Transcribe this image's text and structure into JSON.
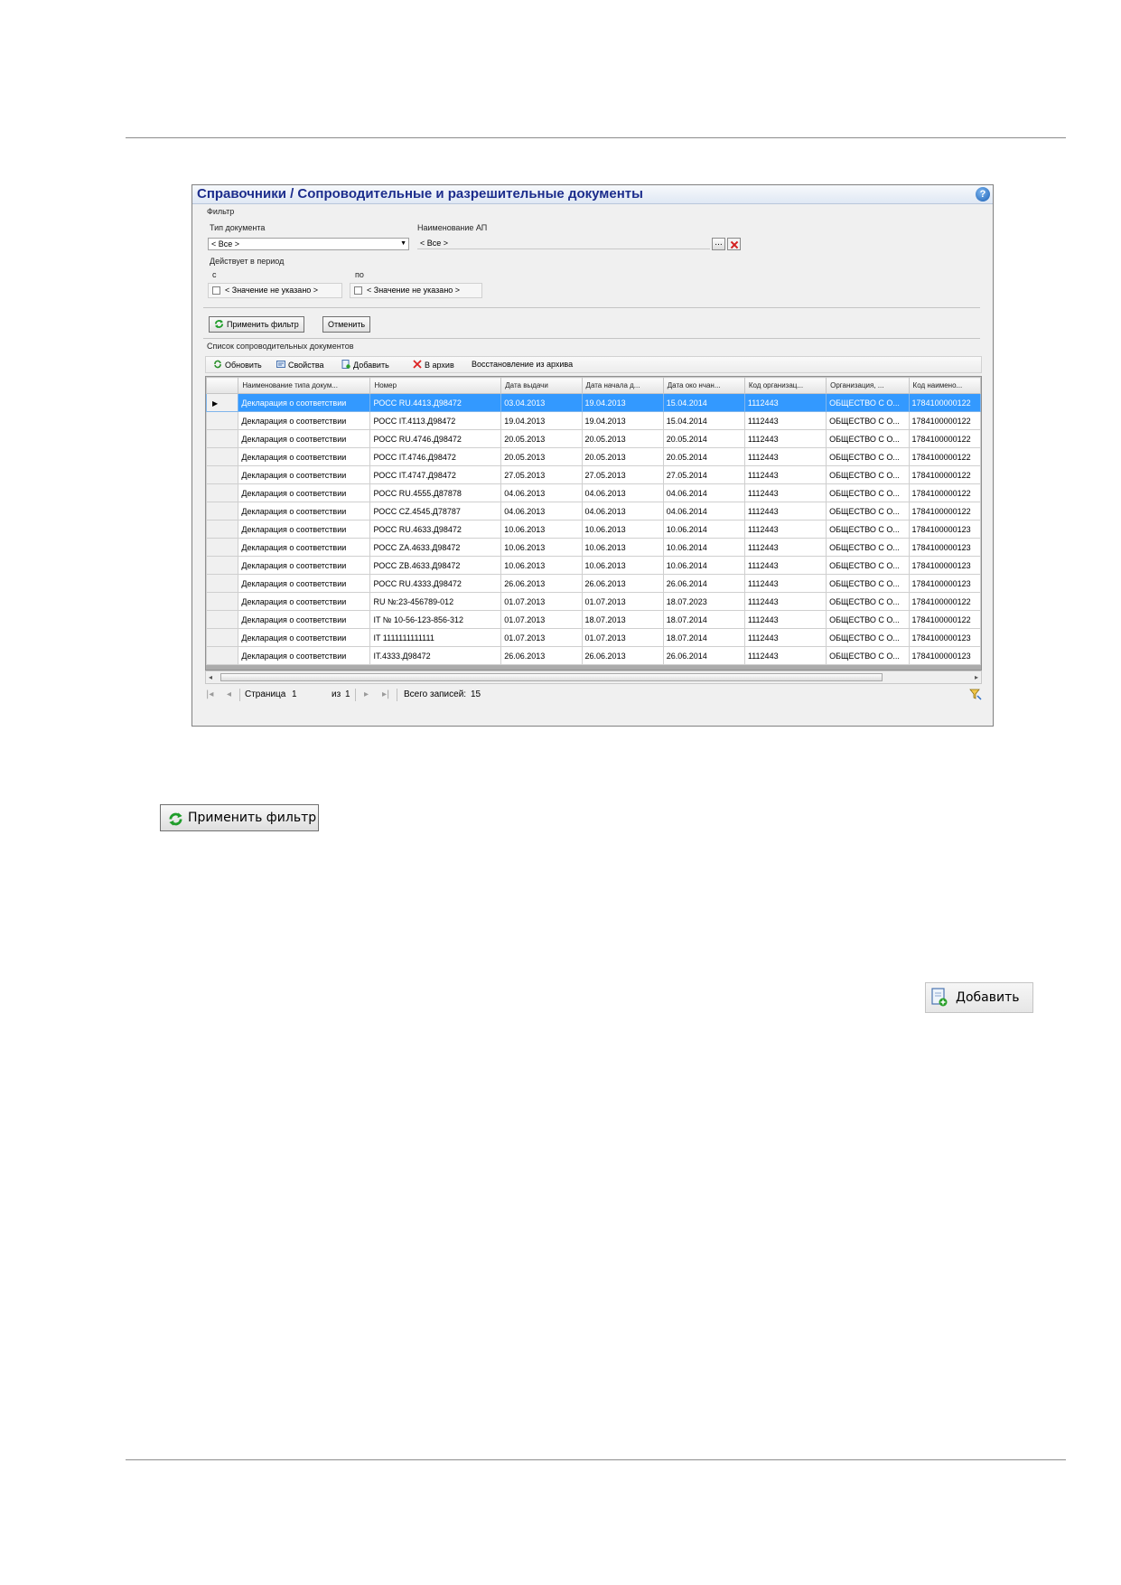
{
  "window": {
    "title": "Справочники / Сопроводительные и разрешительные документы",
    "help_label": "?"
  },
  "filter": {
    "group_label": "Фильтр",
    "doc_type_label": "Тип документа",
    "doc_type_value": "< Все >",
    "ap_name_label": "Наименование АП",
    "ap_name_value": "< Все >",
    "browse_label": "...",
    "period_label": "Действует в период",
    "from_label": "с",
    "to_label": "по",
    "from_value": "< Значение не указано >",
    "to_value": "< Значение не указано >",
    "apply_label": "Применить фильтр",
    "cancel_label": "Отменить"
  },
  "list": {
    "group_label": "Список сопроводительных документов",
    "toolbar": {
      "refresh": "Обновить",
      "properties": "Свойства",
      "add": "Добавить",
      "archive": "В архив",
      "restore": "Восстановление из архива"
    },
    "columns": [
      "Наименование типа докум...",
      "Номер",
      "Дата выдачи",
      "Дата начала д...",
      "Дата око нчан...",
      "Код организац...",
      "Организация, ...",
      "Код наимено..."
    ],
    "rows": [
      [
        "Декларация о соответствии",
        "РОСС RU.4413.Д98472",
        "03.04.2013",
        "19.04.2013",
        "15.04.2014",
        "1112443",
        "ОБЩЕСТВО С О...",
        "1784100000122"
      ],
      [
        "Декларация о соответствии",
        "РОСС IT.4113.Д98472",
        "19.04.2013",
        "19.04.2013",
        "15.04.2014",
        "1112443",
        "ОБЩЕСТВО С О...",
        "1784100000122"
      ],
      [
        "Декларация о соответствии",
        "РОСС RU.4746.Д98472",
        "20.05.2013",
        "20.05.2013",
        "20.05.2014",
        "1112443",
        "ОБЩЕСТВО С О...",
        "1784100000122"
      ],
      [
        "Декларация о соответствии",
        "РОСС IT.4746.Д98472",
        "20.05.2013",
        "20.05.2013",
        "20.05.2014",
        "1112443",
        "ОБЩЕСТВО С О...",
        "1784100000122"
      ],
      [
        "Декларация о соответствии",
        "РОСС IT.4747.Д98472",
        "27.05.2013",
        "27.05.2013",
        "27.05.2014",
        "1112443",
        "ОБЩЕСТВО С О...",
        "1784100000122"
      ],
      [
        "Декларация о соответствии",
        "РОСС RU.4555.Д87878",
        "04.06.2013",
        "04.06.2013",
        "04.06.2014",
        "1112443",
        "ОБЩЕСТВО С О...",
        "1784100000122"
      ],
      [
        "Декларация о соответствии",
        "РОСС CZ.4545.Д78787",
        "04.06.2013",
        "04.06.2013",
        "04.06.2014",
        "1112443",
        "ОБЩЕСТВО С О...",
        "1784100000122"
      ],
      [
        "Декларация о соответствии",
        "РОСС RU.4633.Д98472",
        "10.06.2013",
        "10.06.2013",
        "10.06.2014",
        "1112443",
        "ОБЩЕСТВО С О...",
        "1784100000123"
      ],
      [
        "Декларация о соответствии",
        "РОСС ZA.4633.Д98472",
        "10.06.2013",
        "10.06.2013",
        "10.06.2014",
        "1112443",
        "ОБЩЕСТВО С О...",
        "1784100000123"
      ],
      [
        "Декларация о соответствии",
        "РОСС ZB.4633.Д98472",
        "10.06.2013",
        "10.06.2013",
        "10.06.2014",
        "1112443",
        "ОБЩЕСТВО С О...",
        "1784100000123"
      ],
      [
        "Декларация о соответствии",
        "РОСС RU.4333.Д98472",
        "26.06.2013",
        "26.06.2013",
        "26.06.2014",
        "1112443",
        "ОБЩЕСТВО С О...",
        "1784100000123"
      ],
      [
        "Декларация о соответствии",
        "RU №:23-456789-012",
        "01.07.2013",
        "01.07.2013",
        "18.07.2023",
        "1112443",
        "ОБЩЕСТВО С О...",
        "1784100000122"
      ],
      [
        "Декларация о соответствии",
        "IT № 10-56-123-856-312",
        "01.07.2013",
        "18.07.2013",
        "18.07.2014",
        "1112443",
        "ОБЩЕСТВО С О...",
        "1784100000122"
      ],
      [
        "Декларация о соответствии",
        "IT 1111111111111",
        "01.07.2013",
        "01.07.2013",
        "18.07.2014",
        "1112443",
        "ОБЩЕСТВО С О...",
        "1784100000123"
      ],
      [
        "Декларация о соответствии",
        "IT.4333.Д98472",
        "26.06.2013",
        "26.06.2013",
        "26.06.2014",
        "1112443",
        "ОБЩЕСТВО С О...",
        "1784100000123"
      ]
    ],
    "selected_row": 0
  },
  "pager": {
    "page_label": "Страница",
    "page_value": "1",
    "of_label": "из",
    "of_value": "1",
    "total_label": "Всего записей:",
    "total_value": "15"
  },
  "figures": {
    "apply_filter_label": "Применить фильтр",
    "add_label": "Добавить"
  },
  "colors": {
    "title_text": "#1c2d8c",
    "selection": "#3399ff"
  }
}
